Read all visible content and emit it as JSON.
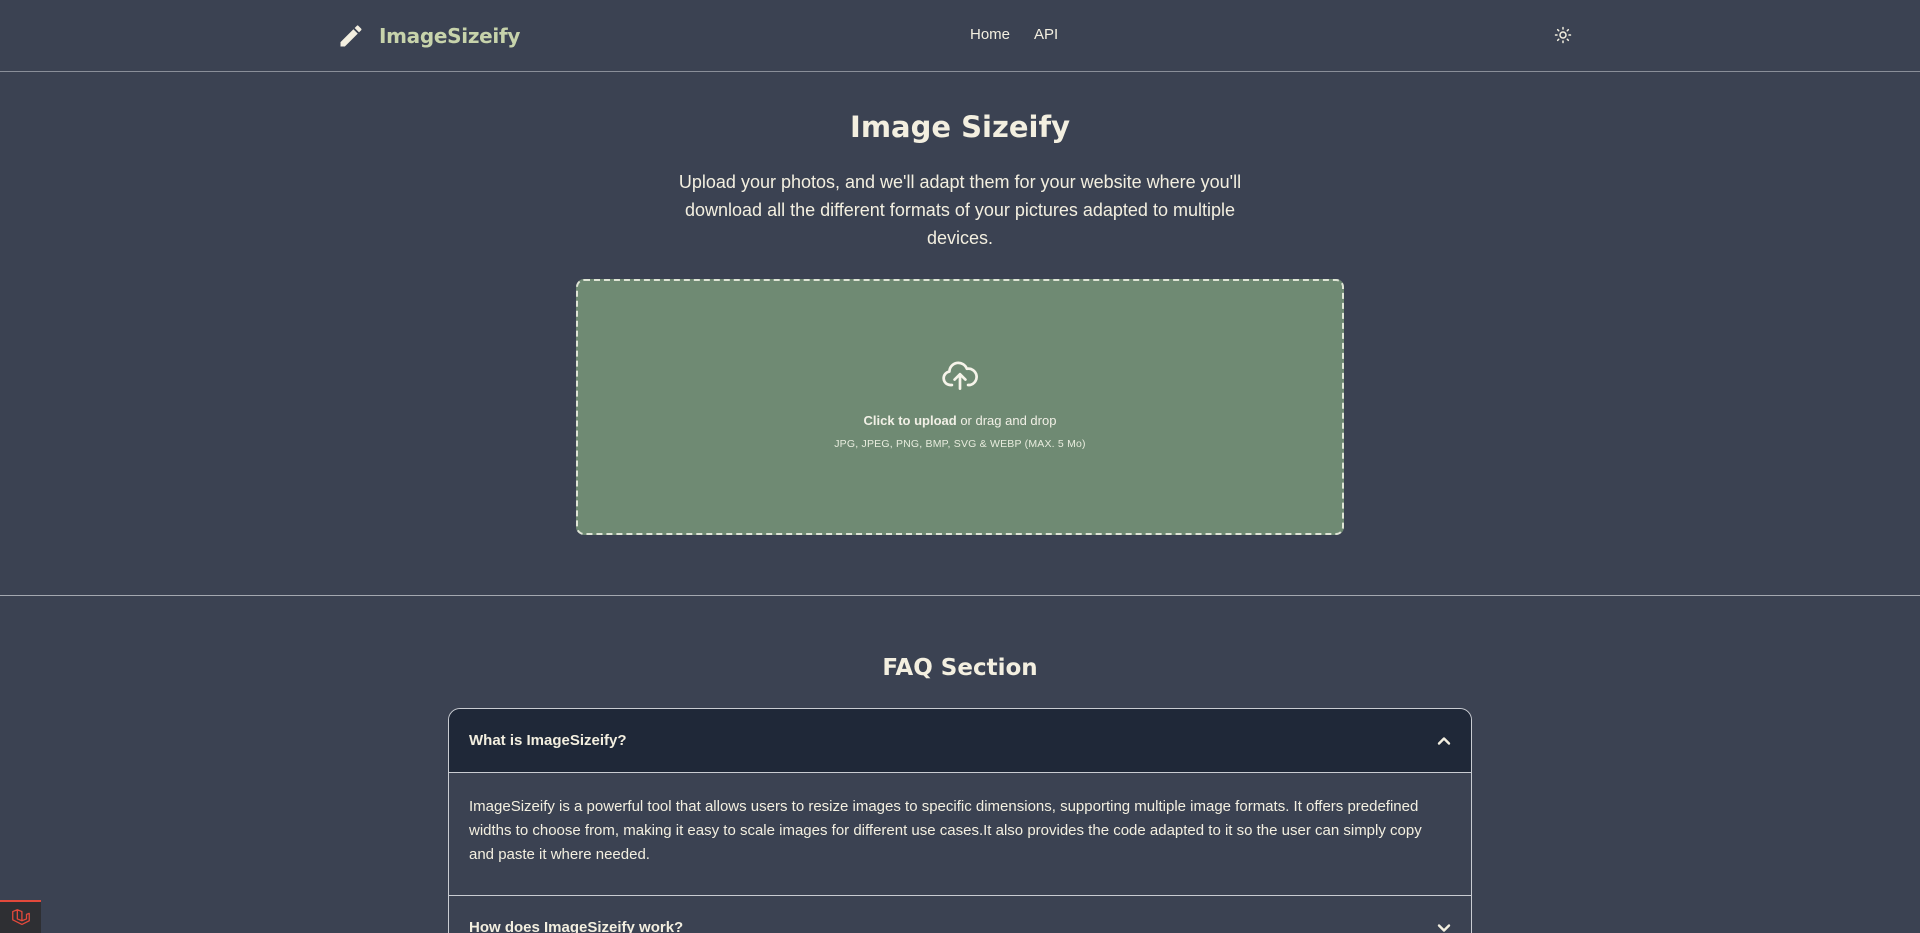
{
  "nav": {
    "brand": "ImageSizeify",
    "brand_icon": "pencil-icon",
    "links": [
      "Home",
      "API"
    ],
    "theme_icon": "sun-icon"
  },
  "hero": {
    "title": "Image Sizeify",
    "description": "Upload your photos, and we'll adapt them for your website where you'll download all the different formats of your pictures adapted to multiple devices."
  },
  "upload": {
    "icon": "cloud-upload-icon",
    "action": "Click to upload",
    "action_rest": "or drag and drop",
    "hint": "JPG, JPEG, PNG, BMP, SVG & WEBP (MAX. 5 Mo)"
  },
  "faq": {
    "title": "FAQ Section",
    "items": [
      {
        "question": "What is ImageSizeify?",
        "answer": "ImageSizeify is a powerful tool that allows users to resize images to specific dimensions, supporting multiple image formats. It offers predefined widths to choose from, making it easy to scale images for different use cases.It also provides the code adapted to it so the user can simply copy and paste it where needed.",
        "expanded": true
      },
      {
        "question": "How does ImageSizeify work?",
        "expanded": false
      }
    ]
  },
  "colors": {
    "background": "#3b4252",
    "dropzone": "#6f8a73",
    "brand_text": "#c7d3ab",
    "faq_header": "#1f2838",
    "laravel_red": "#e3493b"
  }
}
